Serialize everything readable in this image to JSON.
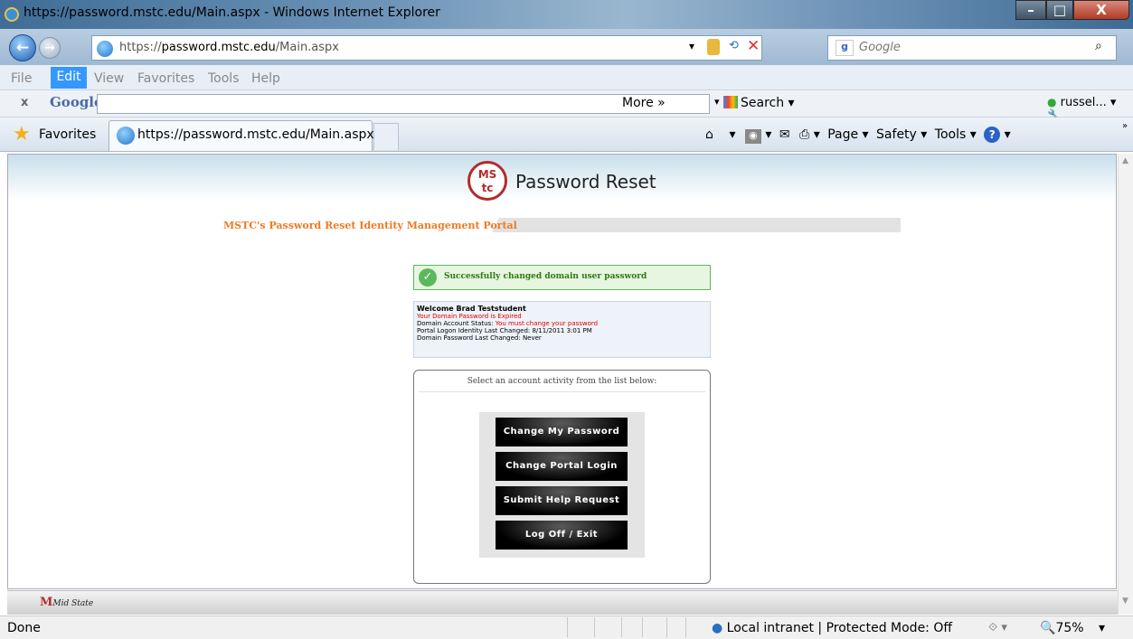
{
  "window": {
    "title": "https://password.mstc.edu/Main.aspx - Windows Internet Explorer",
    "min": "–",
    "max": "□",
    "close": "X"
  },
  "address": {
    "scheme": "https://",
    "host": "password.mstc.edu",
    "path": "/Main.aspx",
    "search_placeholder": "Google"
  },
  "menu": [
    "File",
    "Edit",
    "View",
    "Favorites",
    "Tools",
    "Help"
  ],
  "google_toolbar": {
    "close": "x",
    "logo": "Google",
    "search_label": "Search",
    "more_label": "More »",
    "user": "russel..."
  },
  "favorites": {
    "label": "Favorites",
    "tab_title": "https://password.mstc.edu/Main.aspx"
  },
  "command_bar": {
    "page": "Page",
    "safety": "Safety",
    "tools": "Tools"
  },
  "page": {
    "logo_top": "MS",
    "logo_bottom": "tc",
    "heading": "Password Reset",
    "subtitle": "MSTC's Password Reset Identity Management Portal",
    "success_msg": "Successfully changed domain user password",
    "info": {
      "welcome": "Welcome Brad Teststudent",
      "expired": "Your Domain Password is Expired",
      "status_label": "Domain Account Status: ",
      "status_value": "You must change your password",
      "portal_changed": "Portal Logon Identity Last Changed: 8/11/2011 3:01 PM",
      "domain_changed": "Domain Password Last Changed: Never"
    },
    "panel_title": "Select an account activity from the list below:",
    "buttons": {
      "change_password": "Change My Password",
      "change_login": "Change Portal Login",
      "help_request": "Submit Help Request",
      "logoff": "Log Off / Exit"
    },
    "footer_logo_mark": "M",
    "footer_logo_text": "Mid State"
  },
  "status": {
    "text": "Done",
    "zone": "Local intranet | Protected Mode: Off",
    "zoom": "75%"
  },
  "colors": {
    "accent_orange": "#f07a22",
    "success_green": "#2c7a12",
    "error_red": "#dd0000",
    "brand_red": "#b42b2b"
  }
}
